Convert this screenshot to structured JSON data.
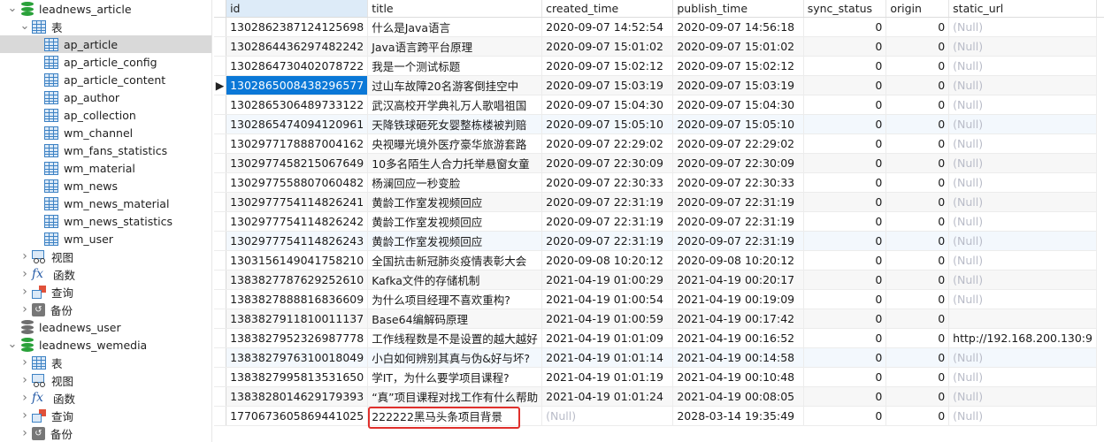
{
  "sidebar": {
    "databases": [
      {
        "name": "leadnews_article",
        "expanded": true,
        "color": "#2aa13a",
        "tables_label": "表",
        "tables": [
          "ap_article",
          "ap_article_config",
          "ap_article_content",
          "ap_author",
          "ap_collection",
          "wm_channel",
          "wm_fans_statistics",
          "wm_material",
          "wm_news",
          "wm_news_material",
          "wm_news_statistics",
          "wm_user"
        ],
        "selected_table": "ap_article",
        "groups": [
          "视图",
          "函数",
          "查询",
          "备份"
        ]
      },
      {
        "name": "leadnews_user",
        "expanded": false,
        "color": "#6e6e6e"
      },
      {
        "name": "leadnews_wemedia",
        "expanded": true,
        "color": "#2aa13a",
        "groups": [
          "表",
          "视图",
          "函数",
          "查询",
          "备份"
        ]
      }
    ],
    "icons": {
      "database": "database-icon",
      "table": "table-icon",
      "view": "view-icon",
      "function": "function-icon",
      "query": "query-icon",
      "backup": "backup-icon"
    }
  },
  "grid": {
    "columns": [
      "id",
      "title",
      "created_time",
      "publish_time",
      "sync_status",
      "origin",
      "static_url"
    ],
    "sorted_column": "id",
    "current_row_marker": "▶",
    "null_text": "(Null)",
    "rows": [
      [
        "1302862387124125698",
        "什么是Java语言",
        "2020-09-07 14:52:54",
        "2020-09-07 14:56:18",
        "0",
        "0",
        "(Null)"
      ],
      [
        "1302864436297482242",
        "Java语言跨平台原理",
        "2020-09-07 15:01:02",
        "2020-09-07 15:01:02",
        "0",
        "0",
        "(Null)"
      ],
      [
        "1302864730402078722",
        "我是一个测试标题",
        "2020-09-07 15:02:12",
        "2020-09-07 15:02:12",
        "0",
        "0",
        "(Null)"
      ],
      [
        "1302865008438296577",
        "过山车故障20名游客倒挂空中",
        "2020-09-07 15:03:19",
        "2020-09-07 15:03:19",
        "0",
        "0",
        "(Null)"
      ],
      [
        "1302865306489733122",
        "武汉高校开学典礼万人歌唱祖国",
        "2020-09-07 15:04:30",
        "2020-09-07 15:04:30",
        "0",
        "0",
        "(Null)"
      ],
      [
        "1302865474094120961",
        "天降铁球砸死女婴整栋楼被判赔",
        "2020-09-07 15:05:10",
        "2020-09-07 15:05:10",
        "0",
        "0",
        "(Null)"
      ],
      [
        "1302977178887004162",
        "央视曝光境外医疗豪华旅游套路",
        "2020-09-07 22:29:02",
        "2020-09-07 22:29:02",
        "0",
        "0",
        "(Null)"
      ],
      [
        "1302977458215067649",
        "10多名陌生人合力托举悬窗女童",
        "2020-09-07 22:30:09",
        "2020-09-07 22:30:09",
        "0",
        "0",
        "(Null)"
      ],
      [
        "1302977558807060482",
        "杨澜回应一秒变脸",
        "2020-09-07 22:30:33",
        "2020-09-07 22:30:33",
        "0",
        "0",
        "(Null)"
      ],
      [
        "1302977754114826241",
        "黄龄工作室发视频回应",
        "2020-09-07 22:31:19",
        "2020-09-07 22:31:19",
        "0",
        "0",
        "(Null)"
      ],
      [
        "1302977754114826242",
        "黄龄工作室发视频回应",
        "2020-09-07 22:31:19",
        "2020-09-07 22:31:19",
        "0",
        "0",
        "(Null)"
      ],
      [
        "1302977754114826243",
        "黄龄工作室发视频回应",
        "2020-09-07 22:31:19",
        "2020-09-07 22:31:19",
        "0",
        "0",
        "(Null)"
      ],
      [
        "1303156149041758210",
        "全国抗击新冠肺炎疫情表彰大会",
        "2020-09-08 10:20:12",
        "2020-09-08 10:20:12",
        "0",
        "0",
        "(Null)"
      ],
      [
        "1383827787629252610",
        "Kafka文件的存储机制",
        "2021-04-19 01:00:29",
        "2021-04-19 00:20:17",
        "0",
        "0",
        "(Null)"
      ],
      [
        "1383827888816836609",
        "为什么项目经理不喜欢重构?",
        "2021-04-19 01:00:54",
        "2021-04-19 00:19:09",
        "0",
        "0",
        "(Null)"
      ],
      [
        "1383827911810011137",
        "Base64编解码原理",
        "2021-04-19 01:00:59",
        "2021-04-19 00:17:42",
        "0",
        "0",
        ""
      ],
      [
        "1383827952326987778",
        "工作线程数是不是设置的越大越好",
        "2021-04-19 01:01:09",
        "2021-04-19 00:16:52",
        "0",
        "0",
        "http://192.168.200.130:9"
      ],
      [
        "1383827976310018049",
        "小白如何辨别其真与伪&好与坏?",
        "2021-04-19 01:01:14",
        "2021-04-19 00:14:58",
        "0",
        "0",
        "(Null)"
      ],
      [
        "1383827995813531650",
        "学IT，为什么要学项目课程?",
        "2021-04-19 01:01:19",
        "2021-04-19 00:10:48",
        "0",
        "0",
        "(Null)"
      ],
      [
        "1383828014629179393",
        "“真”项目课程对找工作有什么帮助",
        "2021-04-19 01:01:24",
        "2021-04-19 00:08:05",
        "0",
        "0",
        "(Null)"
      ],
      [
        "1770673605869441025",
        "222222黑马头条项目背景",
        "(Null)",
        "2028-03-14 19:35:49",
        "0",
        "0",
        "(Null)"
      ]
    ],
    "current_row_index": 3,
    "highlighted_row_index": 20,
    "highlight_color": "#e0302c",
    "selection_color": "#0b78d7"
  }
}
